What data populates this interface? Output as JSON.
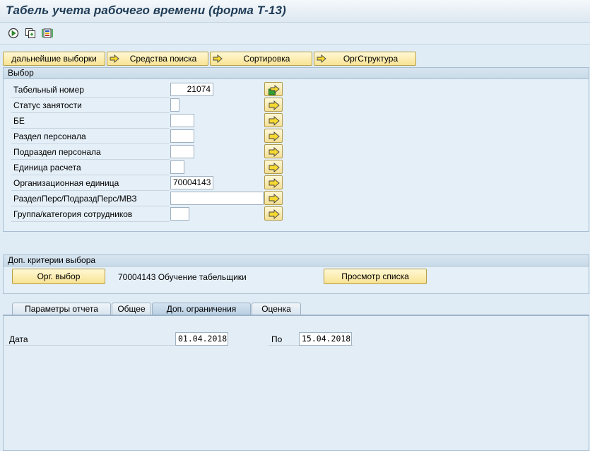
{
  "window": {
    "title": "Табель учета рабочего времени (форма Т-13)"
  },
  "toolbar": {
    "icons": [
      "execute-icon",
      "variant-icon",
      "selection-options-icon"
    ]
  },
  "top_buttons": {
    "further_selections": "дальнейшие выборки",
    "search_helps": "Средства поиска",
    "sorting": "Сортировка",
    "org_structure": "ОргСтруктура"
  },
  "selection": {
    "header": "Выбор",
    "fields": [
      {
        "label": "Табельный номер",
        "value": "21074"
      },
      {
        "label": "Статус занятости",
        "value": ""
      },
      {
        "label": "БЕ",
        "value": ""
      },
      {
        "label": "Раздел персонала",
        "value": ""
      },
      {
        "label": "Подраздел персонала",
        "value": ""
      },
      {
        "label": "Единица расчета",
        "value": ""
      },
      {
        "label": "Организационная единица",
        "value": "70004143"
      },
      {
        "label": "РазделПерс/ПодраздПерс/МВЗ",
        "value": ""
      },
      {
        "label": "Группа/категория сотрудников",
        "value": ""
      }
    ]
  },
  "additional": {
    "header": "Доп. критерии выбора",
    "org_select_button": "Орг. выбор",
    "org_info": "70004143 Обучение табельщики",
    "list_view_button": "Просмотр списка"
  },
  "tabs": [
    {
      "label": "Параметры отчета",
      "active": false
    },
    {
      "label": "Общее",
      "active": false
    },
    {
      "label": "Доп. ограничения",
      "active": true
    },
    {
      "label": "Оценка",
      "active": false
    }
  ],
  "tab_content": {
    "date_label": "Дата",
    "date_from": "01.04.2018",
    "to_label": "По",
    "date_to": "15.04.2018"
  },
  "colors": {
    "accent_button": "#f8e394",
    "background": "#dfebf5",
    "header": "#c9dae8"
  }
}
